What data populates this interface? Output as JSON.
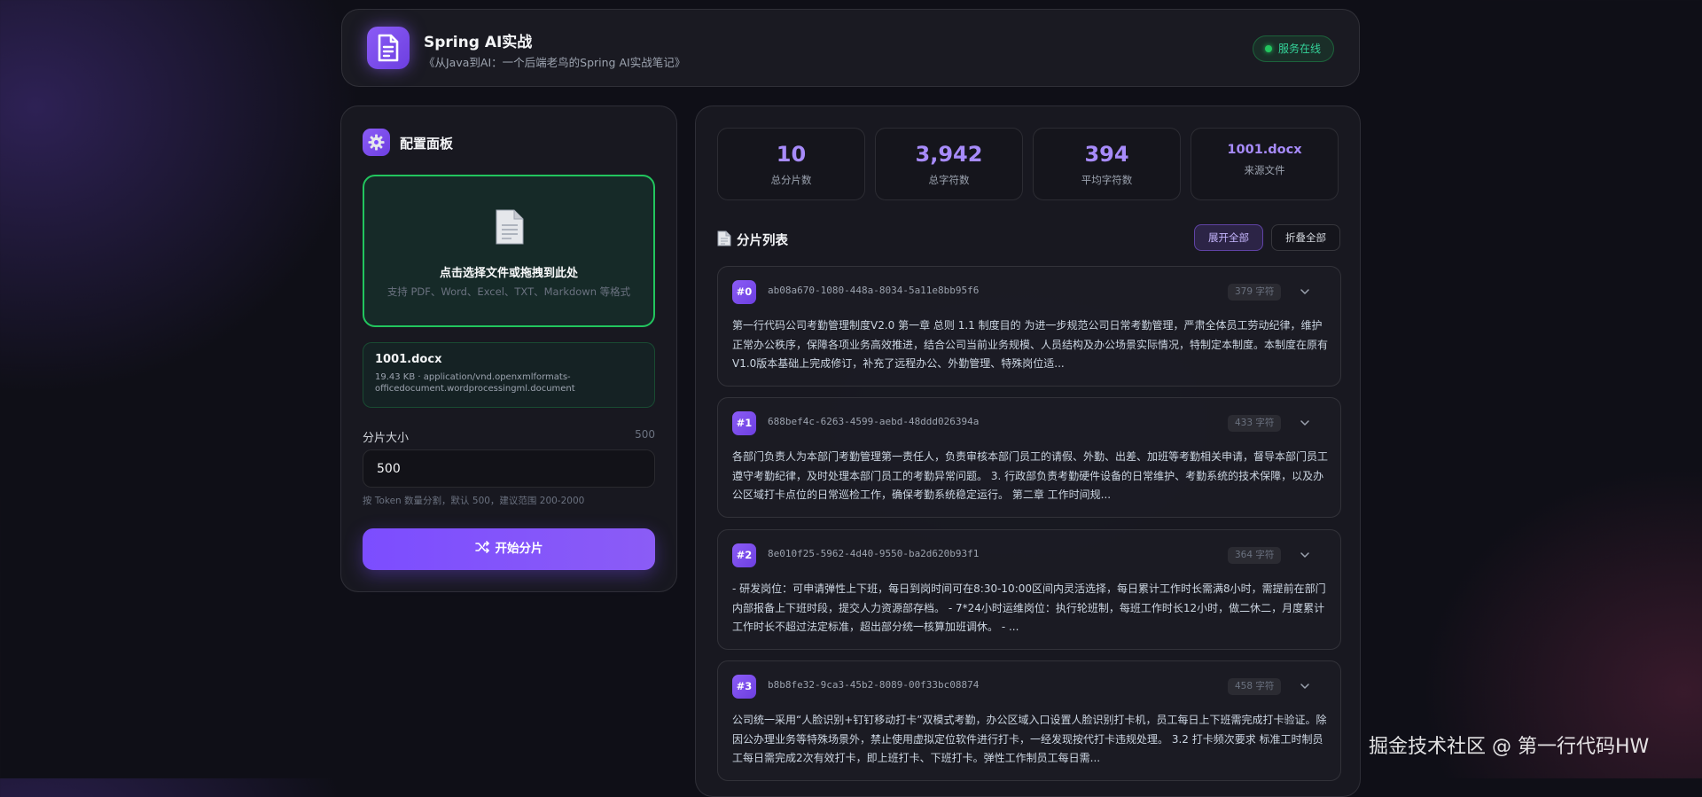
{
  "header": {
    "title": "Spring AI实战",
    "subtitle": "《从Java到AI：一个后端老鸟的Spring AI实战笔记》",
    "status": "服务在线"
  },
  "config": {
    "title": "配置面板",
    "upload": {
      "title": "点击选择文件或拖拽到此处",
      "hint": "支持 PDF、Word、Excel、TXT、Markdown 等格式"
    },
    "file": {
      "name": "1001.docx",
      "meta": "19.43 KB · application/vnd.openxmlformats-officedocument.wordprocessingml.document"
    },
    "chunk_size": {
      "label": "分片大小",
      "display": "500",
      "value": "500",
      "hint": "按 Token 数量分割，默认 500，建议范围 200-2000"
    },
    "start_label": "开始分片"
  },
  "stats": {
    "total_chunks": {
      "value": "10",
      "label": "总分片数"
    },
    "total_chars": {
      "value": "3,942",
      "label": "总字符数"
    },
    "avg_chars": {
      "value": "394",
      "label": "平均字符数"
    },
    "source": {
      "value": "1001.docx",
      "label": "来源文件"
    }
  },
  "list": {
    "title": "分片列表",
    "expand_all": "展开全部",
    "collapse_all": "折叠全部",
    "chunks": [
      {
        "index": "#0",
        "id": "ab08a670-1080-448a-8034-5a11e8bb95f6",
        "chars": "379 字符",
        "text": "第一行代码公司考勤管理制度V2.0 第一章 总则 1.1 制度目的 为进一步规范公司日常考勤管理，严肃全体员工劳动纪律，维护正常办公秩序，保障各项业务高效推进，结合公司当前业务规模、人员结构及办公场景实际情况，特制定本制度。本制度在原有V1.0版本基础上完成修订，补充了远程办公、外勤管理、特殊岗位适..."
      },
      {
        "index": "#1",
        "id": "688bef4c-6263-4599-aebd-48ddd026394a",
        "chars": "433 字符",
        "text": "各部门负责人为本部门考勤管理第一责任人，负责审核本部门员工的请假、外勤、出差、加班等考勤相关申请，督导本部门员工遵守考勤纪律，及时处理本部门员工的考勤异常问题。 3. 行政部负责考勤硬件设备的日常维护、考勤系统的技术保障，以及办公区域打卡点位的日常巡检工作，确保考勤系统稳定运行。 第二章 工作时间规..."
      },
      {
        "index": "#2",
        "id": "8e010f25-5962-4d40-9550-ba2d620b93f1",
        "chars": "364 字符",
        "text": "- 研发岗位：可申请弹性上下班，每日到岗时间可在8:30-10:00区间内灵活选择，每日累计工作时长需满8小时，需提前在部门内部报备上下班时段，提交人力资源部存档。 - 7*24小时运维岗位：执行轮班制，每班工作时长12小时，做二休二，月度累计工作时长不超过法定标准，超出部分统一核算加班调休。 - ..."
      },
      {
        "index": "#3",
        "id": "b8b8fe32-9ca3-45b2-8089-00f33bc08874",
        "chars": "458 字符",
        "text": "公司统一采用“人脸识别+钉钉移动打卡”双模式考勤，办公区域入口设置人脸识别打卡机，员工每日上下班需完成打卡验证。除因公办理业务等特殊场景外，禁止使用虚拟定位软件进行打卡，一经发现按代打卡违规处理。 3.2 打卡频次要求 标准工时制员工每日需完成2次有效打卡，即上班打卡、下班打卡。弹性工作制员工每日需..."
      }
    ]
  },
  "watermark": "掘金技术社区 @ 第一行代码HW",
  "colors": {
    "accent": "#8b5cf6",
    "success": "#22c55e",
    "background": "#0f0f17"
  }
}
